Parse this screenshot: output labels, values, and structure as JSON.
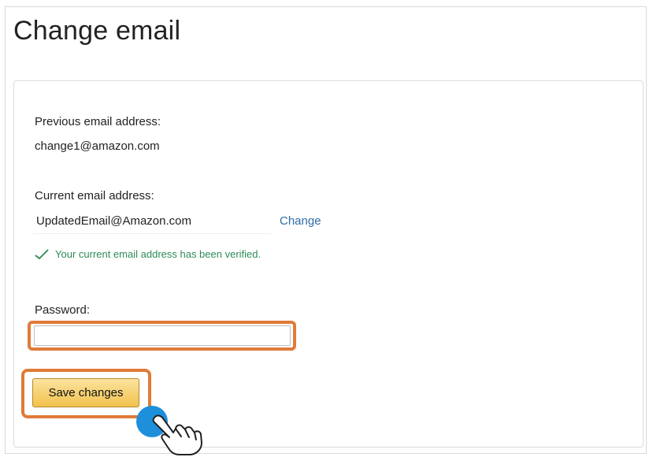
{
  "page": {
    "title": "Change email"
  },
  "form": {
    "previous_label": "Previous email address:",
    "previous_value": "change1@amazon.com",
    "current_label": "Current email address:",
    "current_value": "UpdatedEmail@Amazon.com",
    "change_link": "Change",
    "verified_message": "Your current email address has been verified.",
    "password_label": "Password:",
    "password_value": "",
    "save_label": "Save changes"
  },
  "icons": {
    "verified": "checkmark-icon",
    "cursor": "hand-pointer-icon"
  },
  "colors": {
    "highlight": "#e07b39",
    "verified": "#2e8b57",
    "link": "#2f6da6",
    "button": "#f2c24c",
    "click_indicator": "#1d8fdb"
  }
}
